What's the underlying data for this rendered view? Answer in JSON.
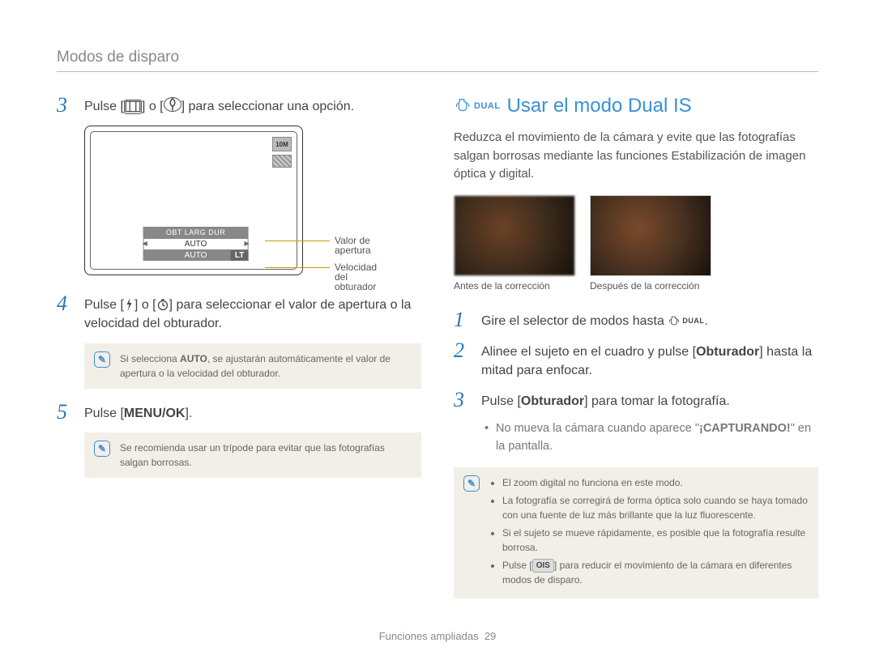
{
  "header": "Modos de disparo",
  "left": {
    "step3": {
      "num": "3",
      "pre": "Pulse [",
      "mid": "] o [",
      "post": "] para seleccionar una opción."
    },
    "lcd": {
      "res": "10M",
      "menu_top": "OBT LARG DUR",
      "menu_mid": "AUTO",
      "menu_bot": "AUTO",
      "lt": "LT",
      "annot1": "Valor de apertura",
      "annot2": "Velocidad del obturador"
    },
    "step4": {
      "num": "4",
      "pre": "Pulse [",
      "mid": "] o [",
      "post": "] para seleccionar el valor de apertura o la velocidad del obturador."
    },
    "note1": {
      "pre": "Si selecciona ",
      "bold": "AUTO",
      "post": ", se ajustarán automáticamente el valor de apertura o la velocidad del obturador."
    },
    "step5": {
      "num": "5",
      "pre": "Pulse [",
      "bold": "MENU/OK",
      "post": "]."
    },
    "note2": "Se recomienda usar un trípode para evitar que las fotografías salgan borrosas."
  },
  "right": {
    "dual_label": "DUAL",
    "title": "Usar el modo Dual IS",
    "intro": "Reduzca el movimiento de la cámara y evite que las fotografías salgan borrosas mediante las funciones Estabilización de imagen óptica y digital.",
    "thumb_before": "Antes de la corrección",
    "thumb_after": "Después de la corrección",
    "step1": {
      "num": "1",
      "text": "Gire el selector de modos hasta ",
      "dual": "DUAL",
      "end": "."
    },
    "step2": {
      "num": "2",
      "pre": "Alinee el sujeto en el cuadro y pulse [",
      "bold": "Obturador",
      "post": "] hasta la mitad para enfocar."
    },
    "step3": {
      "num": "3",
      "pre": "Pulse [",
      "bold": "Obturador",
      "post": "] para tomar la fotografía."
    },
    "sub": {
      "pre": "No mueva la cámara cuando aparece \"",
      "bold": "¡CAPTURANDO!",
      "post": "\" en la pantalla."
    },
    "note": {
      "b1": "El zoom digital no funciona en este modo.",
      "b2": "La fotografía se corregirá de forma óptica solo cuando se haya tomado con una fuente de luz más brillante que la luz fluorescente.",
      "b3": "Si el sujeto se mueve rápidamente, es posible que la fotografía resulte borrosa.",
      "b4_pre": "Pulse [",
      "b4_ois": "OIS",
      "b4_post": "] para reducir el movimiento de la cámara en diferentes modos de disparo."
    }
  },
  "footer": {
    "section": "Funciones ampliadas",
    "page": "29"
  }
}
